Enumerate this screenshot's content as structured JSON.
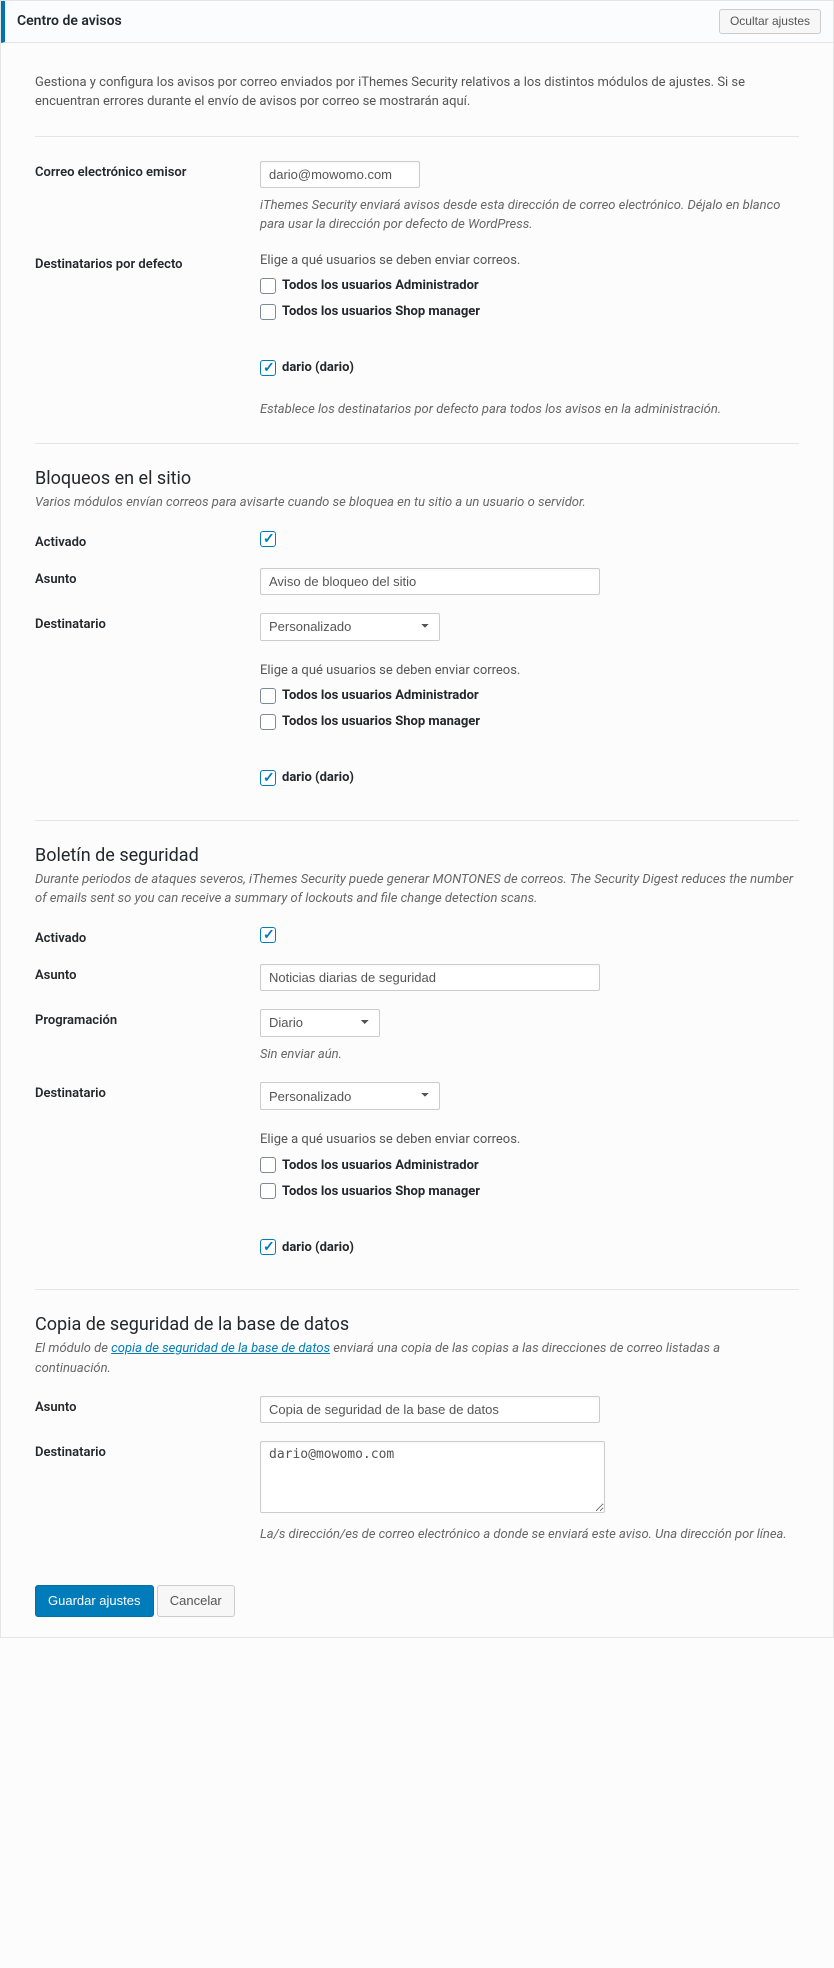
{
  "header": {
    "title": "Centro de avisos",
    "hide_settings": "Ocultar ajustes"
  },
  "intro": "Gestiona y configura los avisos por correo enviados por iThemes Security relativos a los distintos módulos de ajustes. Si se encuentran errores durante el envío de avisos por correo se mostrarán aquí.",
  "from_email": {
    "label": "Correo electrónico emisor",
    "value": "dario@mowomo.com",
    "helper": "iThemes Security enviará avisos desde esta dirección de correo electrónico. Déjalo en blanco para usar la dirección por defecto de WordPress."
  },
  "default_recipients": {
    "label": "Destinatarios por defecto",
    "hint": "Elige a qué usuarios se deben enviar correos.",
    "opt_admin": "Todos los usuarios Administrador",
    "opt_shop": "Todos los usuarios Shop manager",
    "opt_dario": "dario (dario)",
    "helper": "Establece los destinatarios por defecto para todos los avisos en la administración."
  },
  "lockouts": {
    "title": "Bloqueos en el sitio",
    "intro": "Varios módulos envían correos para avisarte cuando se bloquea en tu sitio a un usuario o servidor.",
    "enabled_label": "Activado",
    "subject_label": "Asunto",
    "subject_value": "Aviso de bloqueo del sitio",
    "recipient_label": "Destinatario",
    "recipient_select": "Personalizado",
    "recipient_hint": "Elige a qué usuarios se deben enviar correos.",
    "opt_admin": "Todos los usuarios Administrador",
    "opt_shop": "Todos los usuarios Shop manager",
    "opt_dario": "dario (dario)"
  },
  "digest": {
    "title": "Boletín de seguridad",
    "intro": "Durante periodos de ataques severos, iThemes Security puede generar MONTONES de correos. The Security Digest reduces the number of emails sent so you can receive a summary of lockouts and file change detection scans.",
    "enabled_label": "Activado",
    "subject_label": "Asunto",
    "subject_value": "Noticias diarias de seguridad",
    "schedule_label": "Programación",
    "schedule_value": "Diario",
    "schedule_status": "Sin enviar aún.",
    "recipient_label": "Destinatario",
    "recipient_select": "Personalizado",
    "recipient_hint": "Elige a qué usuarios se deben enviar correos.",
    "opt_admin": "Todos los usuarios Administrador",
    "opt_shop": "Todos los usuarios Shop manager",
    "opt_dario": "dario (dario)"
  },
  "backup": {
    "title": "Copia de seguridad de la base de datos",
    "intro_prefix": "El módulo de ",
    "intro_link": "copia de seguridad de la base de datos",
    "intro_suffix": " enviará una copia de las copias a las direcciones de correo listadas a continuación.",
    "subject_label": "Asunto",
    "subject_value": "Copia de seguridad de la base de datos",
    "recipient_label": "Destinatario",
    "recipient_value": "dario@mowomo.com",
    "recipient_helper": "La/s dirección/es de correo electrónico a donde se enviará este aviso. Una dirección por línea."
  },
  "actions": {
    "save": "Guardar ajustes",
    "cancel": "Cancelar"
  }
}
